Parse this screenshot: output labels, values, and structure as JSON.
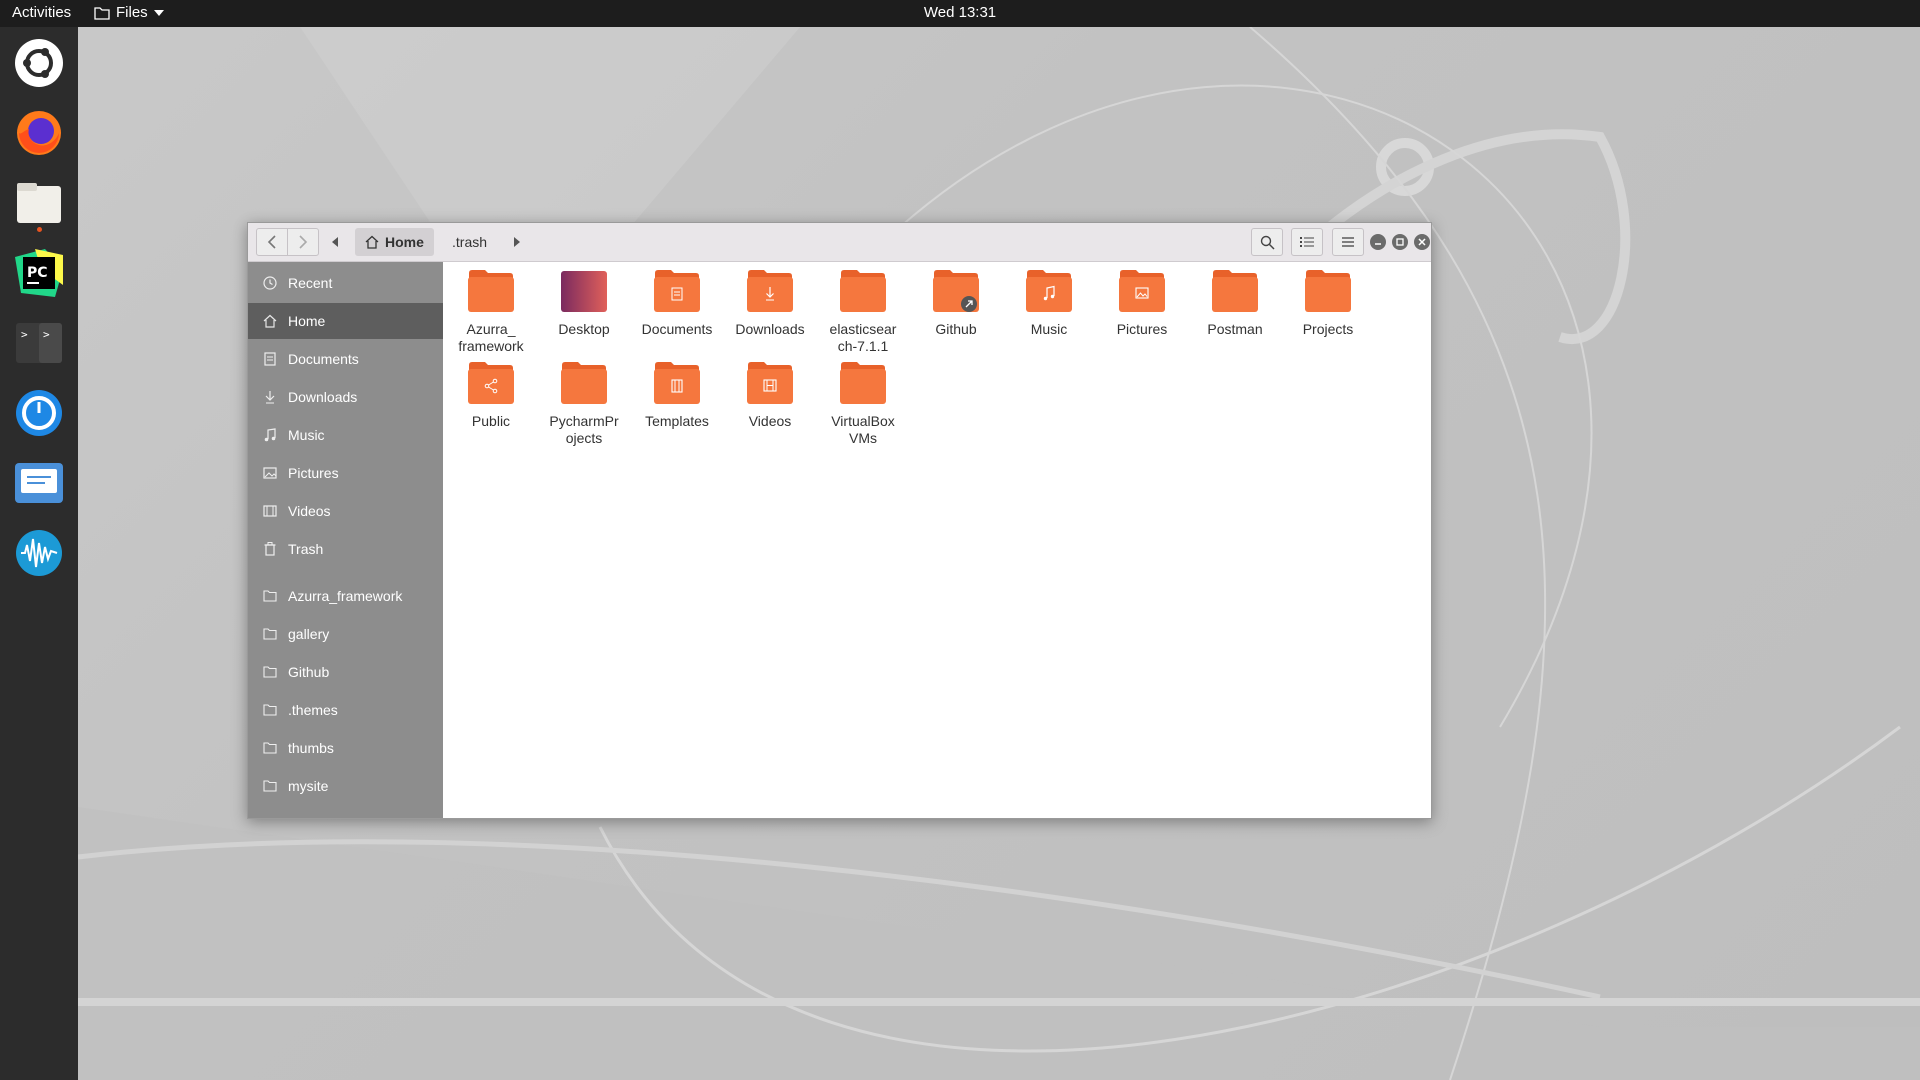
{
  "topbar": {
    "activities": "Activities",
    "app_menu": "Files",
    "clock": "Wed 13:31"
  },
  "dock": {
    "items": [
      "ubuntu-logo-icon",
      "firefox-icon",
      "files-icon",
      "pycharm-icon",
      "terminal-icon",
      "timer-icon",
      "mail-icon",
      "audio-icon"
    ]
  },
  "window": {
    "breadcrumb": {
      "home": "Home",
      "current": ".trash"
    },
    "sidebar": {
      "places": [
        {
          "label": "Recent",
          "icon": "clock-icon"
        },
        {
          "label": "Home",
          "icon": "home-icon",
          "selected": true
        },
        {
          "label": "Documents",
          "icon": "document-icon"
        },
        {
          "label": "Downloads",
          "icon": "download-icon"
        },
        {
          "label": "Music",
          "icon": "music-icon"
        },
        {
          "label": "Pictures",
          "icon": "picture-icon"
        },
        {
          "label": "Videos",
          "icon": "video-icon"
        },
        {
          "label": "Trash",
          "icon": "trash-icon"
        }
      ],
      "bookmarks": [
        {
          "label": "Azurra_framework"
        },
        {
          "label": "gallery"
        },
        {
          "label": "Github"
        },
        {
          "label": ".themes"
        },
        {
          "label": "thumbs"
        },
        {
          "label": "mysite"
        }
      ]
    },
    "files": [
      {
        "name": "Azurra_\nframework",
        "emblem": "none"
      },
      {
        "name": "Desktop",
        "emblem": "desktop"
      },
      {
        "name": "Documents",
        "emblem": "document"
      },
      {
        "name": "Downloads",
        "emblem": "download"
      },
      {
        "name": "elasticsear\nch-7.1.1",
        "emblem": "none"
      },
      {
        "name": "Github",
        "emblem": "link"
      },
      {
        "name": "Music",
        "emblem": "music"
      },
      {
        "name": "Pictures",
        "emblem": "picture"
      },
      {
        "name": "Postman",
        "emblem": "none"
      },
      {
        "name": "Projects",
        "emblem": "none"
      },
      {
        "name": "Public",
        "emblem": "share"
      },
      {
        "name": "PycharmPr\nojects",
        "emblem": "none"
      },
      {
        "name": "Templates",
        "emblem": "template"
      },
      {
        "name": "Videos",
        "emblem": "video"
      },
      {
        "name": "VirtualBox\nVMs",
        "emblem": "none"
      }
    ]
  },
  "colors": {
    "folder_orange": "#f5773e",
    "folder_tab": "#e8612a",
    "accent": "#e95420",
    "sidebar_bg": "#8d8d8d",
    "sidebar_selected": "#5e5e5e"
  }
}
